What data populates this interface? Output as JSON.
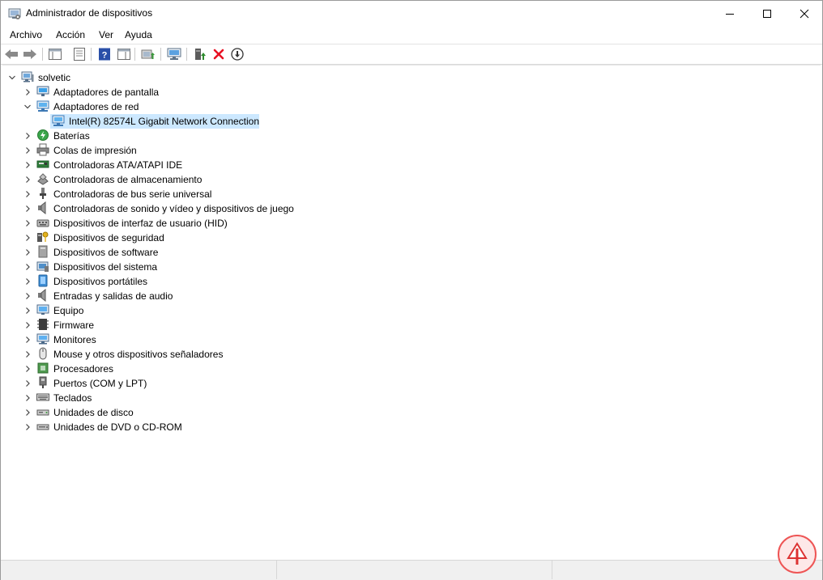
{
  "window": {
    "title": "Administrador de dispositivos"
  },
  "menu": [
    "Archivo",
    "Acción",
    "Ver",
    "Ayuda"
  ],
  "tree": {
    "root": "solvetic",
    "categories": [
      {
        "label": "Adaptadores de pantalla",
        "icon": "display-adapter-icon",
        "expanded": false
      },
      {
        "label": "Adaptadores de red",
        "icon": "network-adapter-icon",
        "expanded": true,
        "children": [
          {
            "label": "Intel(R) 82574L Gigabit Network Connection",
            "icon": "network-adapter-icon",
            "selected": true
          }
        ]
      },
      {
        "label": "Baterías",
        "icon": "battery-icon",
        "expanded": false
      },
      {
        "label": "Colas de impresión",
        "icon": "printer-icon",
        "expanded": false
      },
      {
        "label": "Controladoras ATA/ATAPI IDE",
        "icon": "ide-controller-icon",
        "expanded": false
      },
      {
        "label": "Controladoras de almacenamiento",
        "icon": "storage-controller-icon",
        "expanded": false
      },
      {
        "label": "Controladoras de bus serie universal",
        "icon": "usb-icon",
        "expanded": false
      },
      {
        "label": "Controladoras de sonido y vídeo y dispositivos de juego",
        "icon": "speaker-icon",
        "expanded": false
      },
      {
        "label": "Dispositivos de interfaz de usuario (HID)",
        "icon": "hid-icon",
        "expanded": false
      },
      {
        "label": "Dispositivos de seguridad",
        "icon": "security-device-icon",
        "expanded": false
      },
      {
        "label": "Dispositivos de software",
        "icon": "software-device-icon",
        "expanded": false
      },
      {
        "label": "Dispositivos del sistema",
        "icon": "system-device-icon",
        "expanded": false
      },
      {
        "label": "Dispositivos portátiles",
        "icon": "portable-device-icon",
        "expanded": false
      },
      {
        "label": "Entradas y salidas de audio",
        "icon": "speaker-icon",
        "expanded": false
      },
      {
        "label": "Equipo",
        "icon": "computer-icon",
        "expanded": false
      },
      {
        "label": "Firmware",
        "icon": "firmware-icon",
        "expanded": false
      },
      {
        "label": "Monitores",
        "icon": "monitor-icon",
        "expanded": false
      },
      {
        "label": "Mouse y otros dispositivos señaladores",
        "icon": "mouse-icon",
        "expanded": false
      },
      {
        "label": "Procesadores",
        "icon": "processor-icon",
        "expanded": false
      },
      {
        "label": "Puertos (COM y LPT)",
        "icon": "port-icon",
        "expanded": false
      },
      {
        "label": "Teclados",
        "icon": "keyboard-icon",
        "expanded": false
      },
      {
        "label": "Unidades de disco",
        "icon": "disk-drive-icon",
        "expanded": false
      },
      {
        "label": "Unidades de DVD o CD-ROM",
        "icon": "dvd-drive-icon",
        "expanded": false
      }
    ]
  },
  "toolbar": [
    "back-icon",
    "forward-icon",
    "show-hide-tree-icon",
    "properties-icon",
    "help-icon",
    "action-pane-icon",
    "update-driver-icon",
    "scan-hardware-icon",
    "add-driver-icon",
    "uninstall-icon",
    "disable-icon"
  ],
  "colors": {
    "selection": "#cce8ff",
    "accent": "#0078d4",
    "uninstall": "#e81123"
  }
}
